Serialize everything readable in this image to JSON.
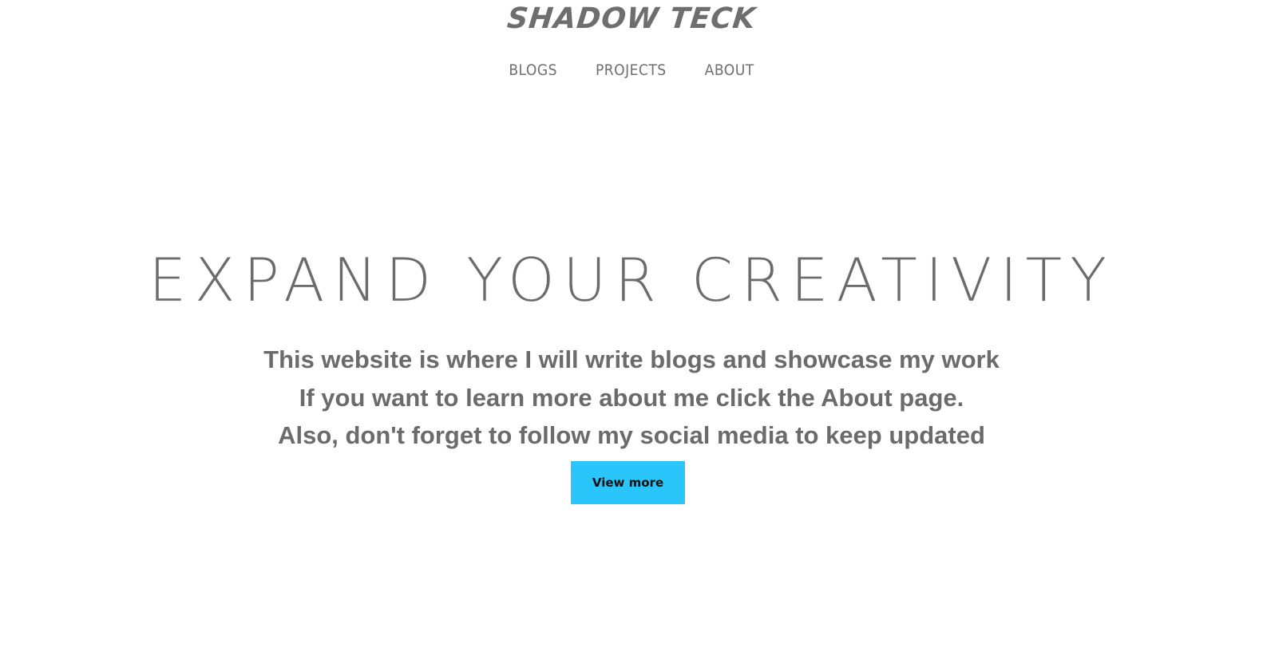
{
  "header": {
    "logo_text": "SHADOW TECK"
  },
  "nav": {
    "items": [
      {
        "label": "BLOGS"
      },
      {
        "label": "PROJECTS"
      },
      {
        "label": "ABOUT"
      }
    ]
  },
  "hero": {
    "title": "EXPAND YOUR CREATIVITY",
    "lines": [
      "This website is where I will write blogs and showcase my work",
      "If you want to learn more about me click the About page.",
      "Also, don't forget to follow my social media to keep updated"
    ],
    "button_label": "View more"
  },
  "colors": {
    "text": "#666666",
    "button": "#2ac5fb",
    "background": "#ffffff"
  }
}
